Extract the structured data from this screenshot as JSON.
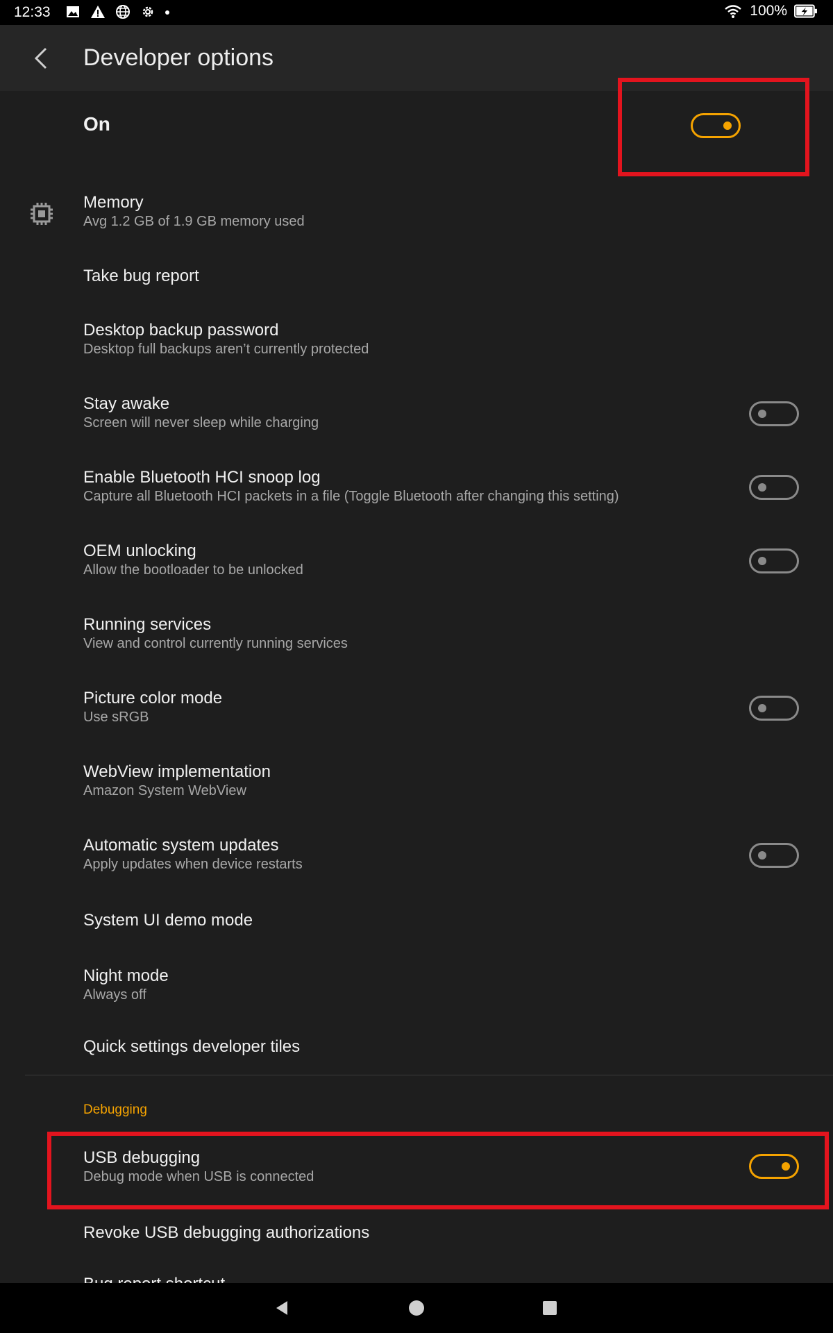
{
  "status_bar": {
    "time": "12:33",
    "battery": "100%",
    "icons": [
      "image-icon",
      "warning-icon",
      "globe-icon",
      "gear-icon",
      "dot-icon",
      "wifi-icon",
      "battery-charging-icon"
    ]
  },
  "app_bar": {
    "title": "Developer options",
    "back_icon": "back-chevron-icon"
  },
  "master": {
    "label": "On",
    "checked": true
  },
  "rows": [
    {
      "title": "Memory",
      "subtitle": "Avg 1.2 GB of 1.9 GB memory used",
      "icon": "memory-chip-icon"
    },
    {
      "title": "Take bug report",
      "subtitle": ""
    },
    {
      "title": "Desktop backup password",
      "subtitle": "Desktop full backups aren’t currently protected"
    },
    {
      "title": "Stay awake",
      "subtitle": "Screen will never sleep while charging",
      "toggle": false
    },
    {
      "title": "Enable Bluetooth HCI snoop log",
      "subtitle": "Capture all Bluetooth HCI packets in a file (Toggle Bluetooth after changing this setting)",
      "toggle": false
    },
    {
      "title": "OEM unlocking",
      "subtitle": "Allow the bootloader to be unlocked",
      "toggle": false
    },
    {
      "title": "Running services",
      "subtitle": "View and control currently running services"
    },
    {
      "title": "Picture color mode",
      "subtitle": "Use sRGB",
      "toggle": false
    },
    {
      "title": "WebView implementation",
      "subtitle": "Amazon System WebView"
    },
    {
      "title": "Automatic system updates",
      "subtitle": "Apply updates when device restarts",
      "toggle": false
    },
    {
      "title": "System UI demo mode",
      "subtitle": ""
    },
    {
      "title": "Night mode",
      "subtitle": "Always off"
    },
    {
      "title": "Quick settings developer tiles",
      "subtitle": ""
    }
  ],
  "debugging": {
    "section_label": "Debugging",
    "usb_title": "USB debugging",
    "usb_subtitle": "Debug mode when USB is connected",
    "usb_checked": true,
    "revoke_title": "Revoke USB debugging authorizations",
    "partial_title": "Bug report shortcut"
  },
  "colors": {
    "accent": "#f5a300",
    "highlight": "#e3141e",
    "background": "#1e1e1e"
  },
  "nav_bar": {
    "icons": [
      "nav-back-icon",
      "nav-home-icon",
      "nav-recents-icon"
    ]
  }
}
